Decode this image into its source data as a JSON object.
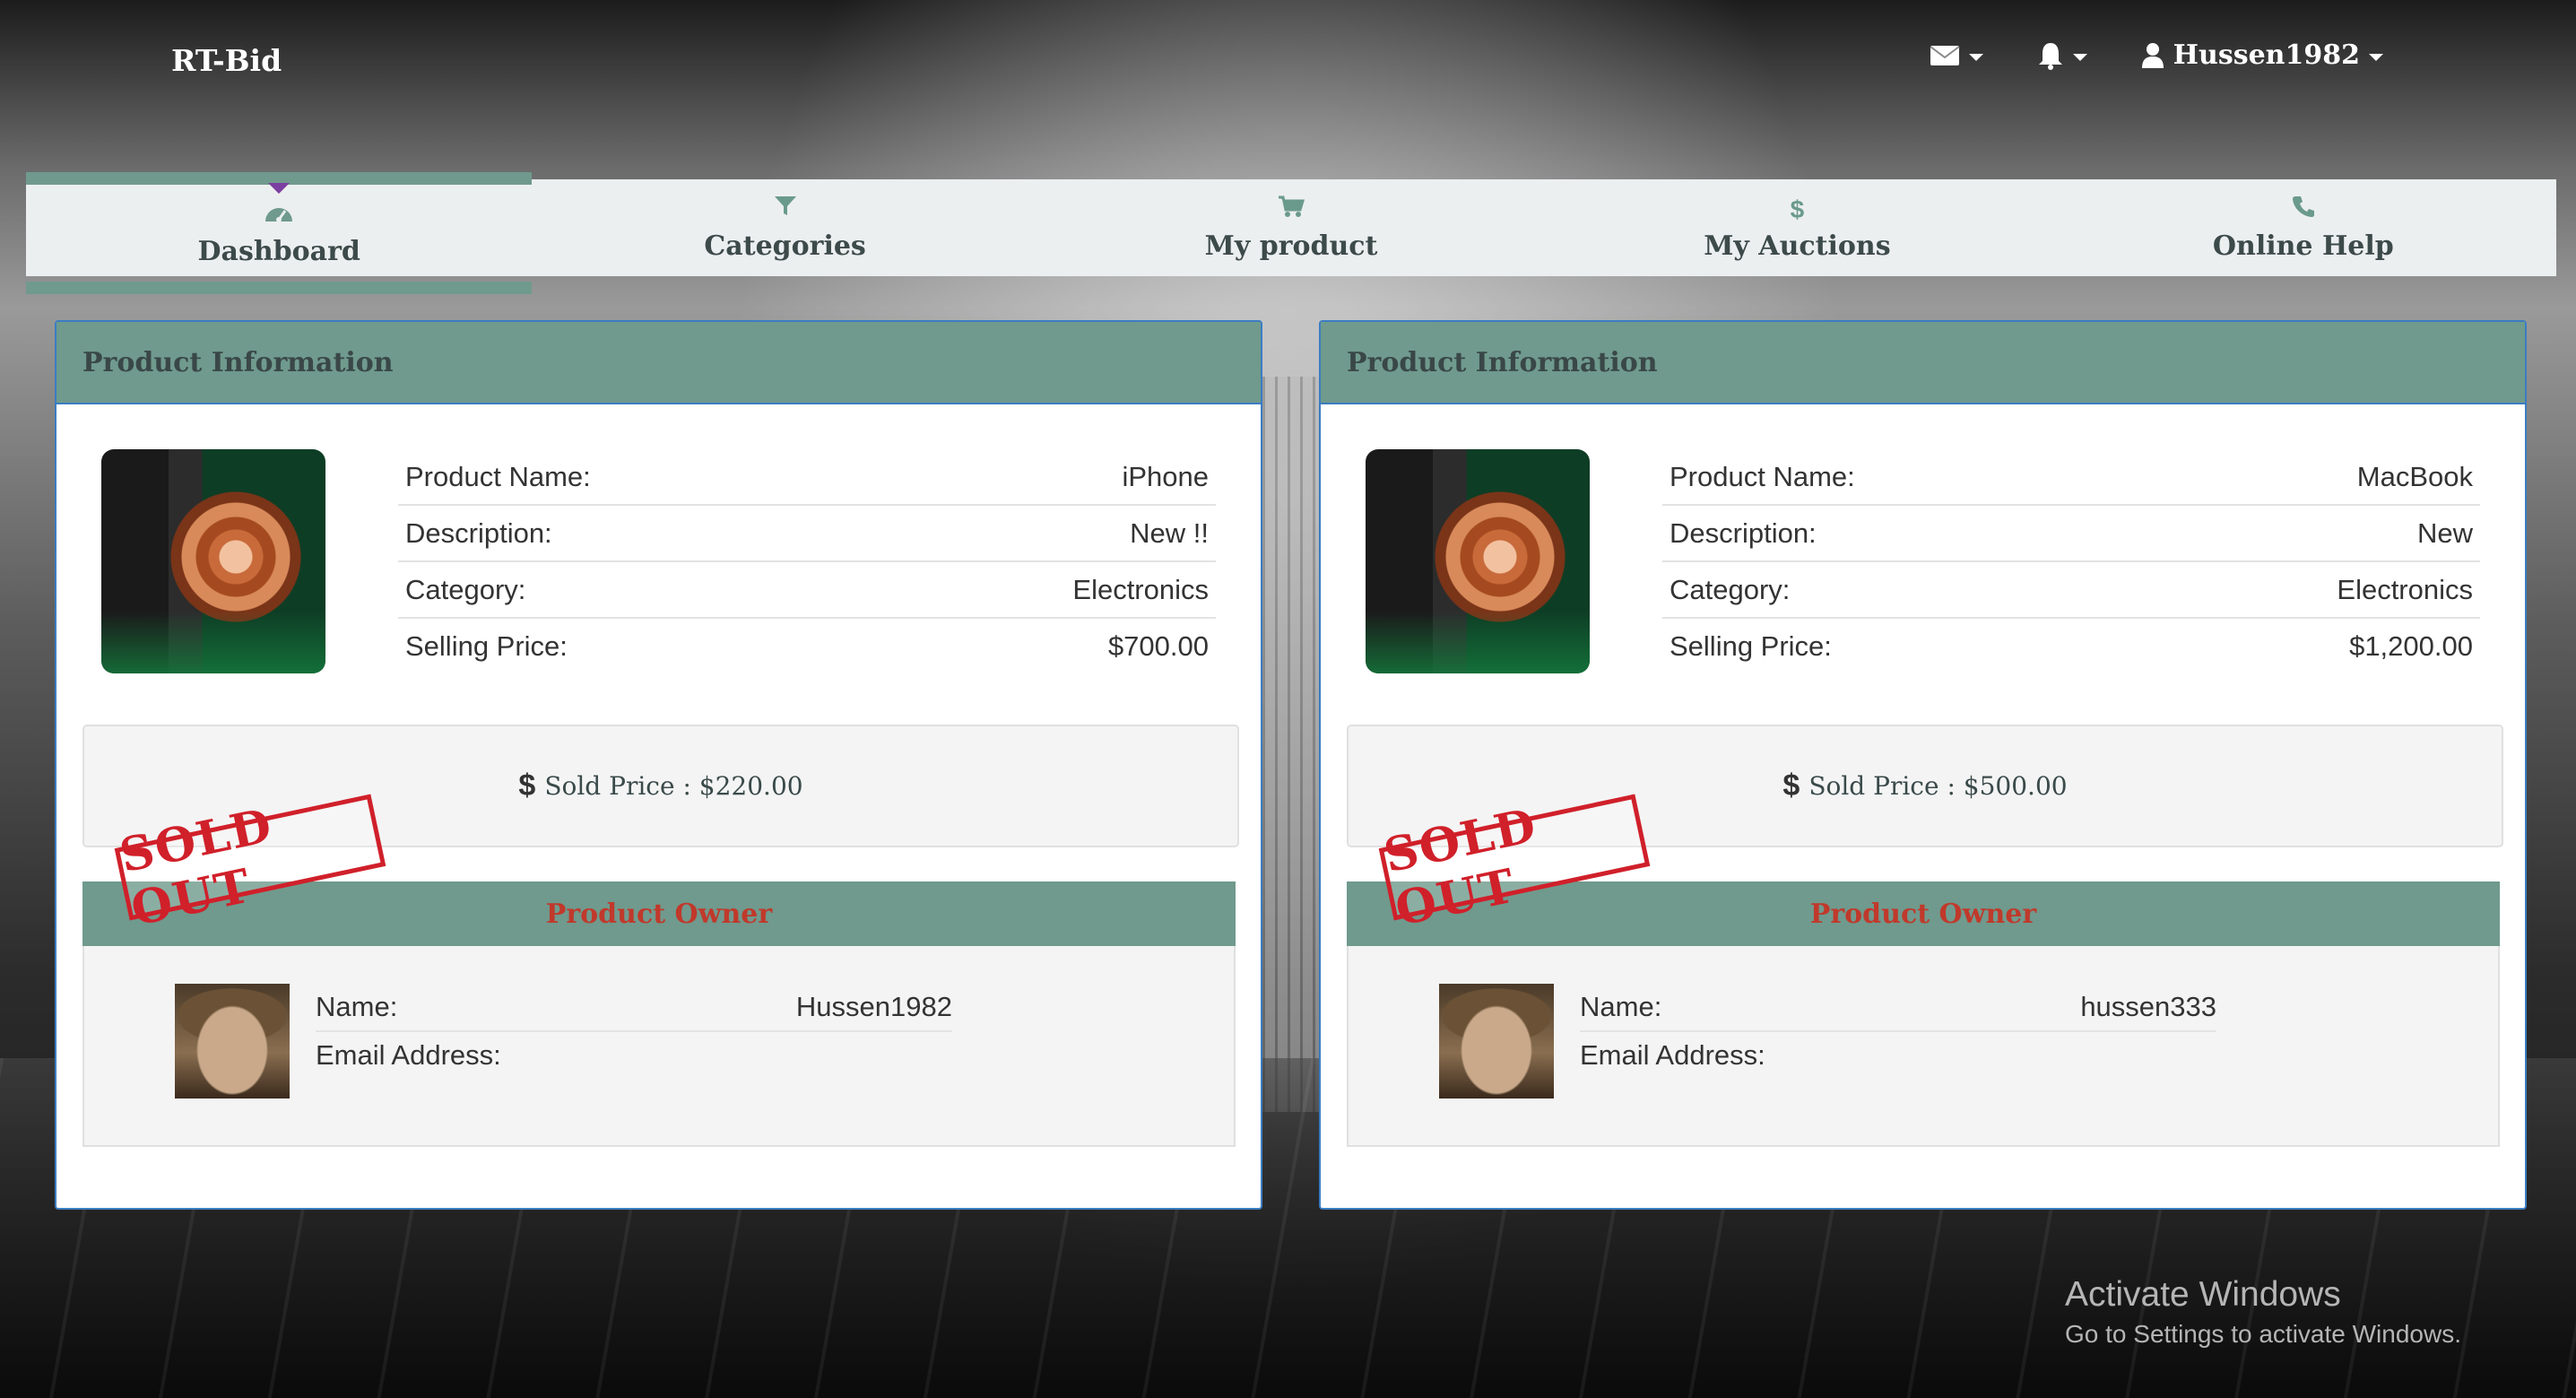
{
  "brand": "RT-Bid",
  "topbar": {
    "user": "Hussen1982",
    "mail_icon": "envelope-icon",
    "bell_icon": "bell-icon",
    "user_icon": "user-icon"
  },
  "nav": [
    {
      "label": "Dashboard",
      "icon": "dashboard-icon",
      "active": true
    },
    {
      "label": "Categories",
      "icon": "filter-icon",
      "active": false
    },
    {
      "label": "My product",
      "icon": "cart-icon",
      "active": false
    },
    {
      "label": "My Auctions",
      "icon": "dollar-icon",
      "active": false
    },
    {
      "label": "Online Help",
      "icon": "phone-icon",
      "active": false
    }
  ],
  "products": [
    {
      "header": "Product Information",
      "rows": [
        {
          "label": "Product Name:",
          "value": "iPhone"
        },
        {
          "label": "Description:",
          "value": "New !!"
        },
        {
          "label": "Category:",
          "value": "Electronics"
        },
        {
          "label": "Selling Price:",
          "value": "$700.00"
        }
      ],
      "sold_price": "Sold Price : $220.00",
      "stamp": "SOLD OUT",
      "owner_header": "Product Owner",
      "owner": [
        {
          "label": "Name:",
          "value": "Hussen1982"
        },
        {
          "label": "Email Address:",
          "value": ""
        }
      ]
    },
    {
      "header": "Product Information",
      "rows": [
        {
          "label": "Product Name:",
          "value": "MacBook"
        },
        {
          "label": "Description:",
          "value": "New"
        },
        {
          "label": "Category:",
          "value": "Electronics"
        },
        {
          "label": "Selling Price:",
          "value": "$1,200.00"
        }
      ],
      "sold_price": "Sold Price : $500.00",
      "stamp": "SOLD OUT",
      "owner_header": "Product Owner",
      "owner": [
        {
          "label": "Name:",
          "value": "hussen333"
        },
        {
          "label": "Email Address:",
          "value": ""
        }
      ]
    }
  ],
  "watermark": {
    "line1": "Activate Windows",
    "line2": "Go to Settings to activate Windows."
  },
  "colors": {
    "accent": "#6f9a8d",
    "border": "#3b7dc2",
    "stamp": "#d0202a",
    "owner_title": "#c0392b"
  }
}
